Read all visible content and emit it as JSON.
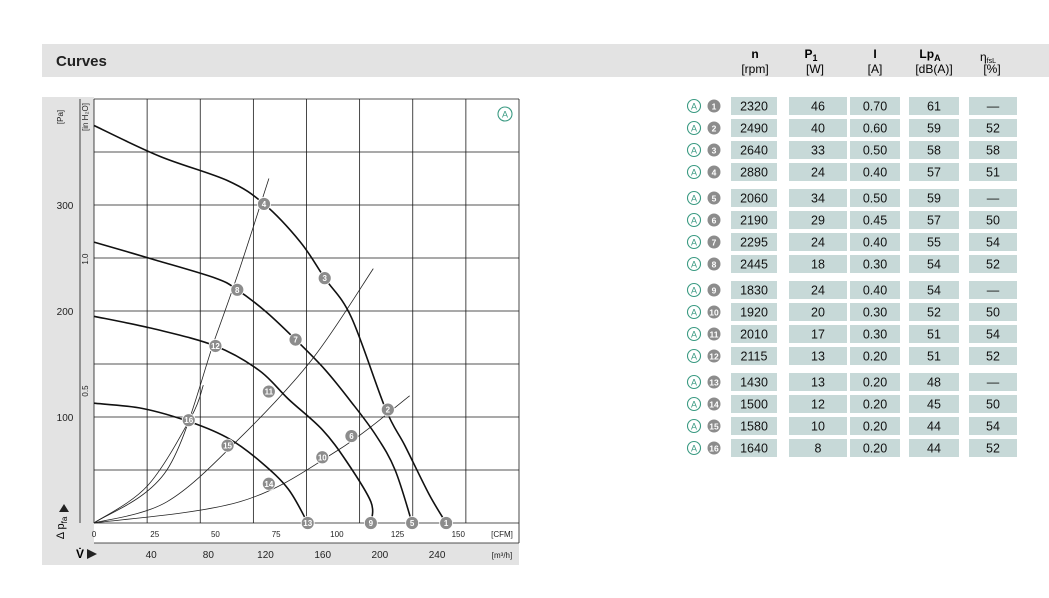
{
  "section_title": "Curves",
  "table": {
    "headers": [
      {
        "main": "n",
        "sub": "",
        "unit": "[rpm]"
      },
      {
        "main": "P",
        "sub": "1",
        "unit": "[W]"
      },
      {
        "main": "I",
        "sub": "",
        "unit": "[A]"
      },
      {
        "main": "Lp",
        "sub": "A",
        "unit": "[dB(A)]"
      },
      {
        "main": "η",
        "sub": "fsL",
        "unit": "[%]"
      }
    ],
    "groups": [
      [
        {
          "mode": "A",
          "id": "1",
          "n": "2320",
          "p1": "46",
          "i": "0.70",
          "lpa": "61",
          "eta": "—"
        },
        {
          "mode": "A",
          "id": "2",
          "n": "2490",
          "p1": "40",
          "i": "0.60",
          "lpa": "59",
          "eta": "52"
        },
        {
          "mode": "A",
          "id": "3",
          "n": "2640",
          "p1": "33",
          "i": "0.50",
          "lpa": "58",
          "eta": "58"
        },
        {
          "mode": "A",
          "id": "4",
          "n": "2880",
          "p1": "24",
          "i": "0.40",
          "lpa": "57",
          "eta": "51"
        }
      ],
      [
        {
          "mode": "A",
          "id": "5",
          "n": "2060",
          "p1": "34",
          "i": "0.50",
          "lpa": "59",
          "eta": "—"
        },
        {
          "mode": "A",
          "id": "6",
          "n": "2190",
          "p1": "29",
          "i": "0.45",
          "lpa": "57",
          "eta": "50"
        },
        {
          "mode": "A",
          "id": "7",
          "n": "2295",
          "p1": "24",
          "i": "0.40",
          "lpa": "55",
          "eta": "54"
        },
        {
          "mode": "A",
          "id": "8",
          "n": "2445",
          "p1": "18",
          "i": "0.30",
          "lpa": "54",
          "eta": "52"
        }
      ],
      [
        {
          "mode": "A",
          "id": "9",
          "n": "1830",
          "p1": "24",
          "i": "0.40",
          "lpa": "54",
          "eta": "—"
        },
        {
          "mode": "A",
          "id": "10",
          "n": "1920",
          "p1": "20",
          "i": "0.30",
          "lpa": "52",
          "eta": "50"
        },
        {
          "mode": "A",
          "id": "11",
          "n": "2010",
          "p1": "17",
          "i": "0.30",
          "lpa": "51",
          "eta": "54"
        },
        {
          "mode": "A",
          "id": "12",
          "n": "2115",
          "p1": "13",
          "i": "0.20",
          "lpa": "51",
          "eta": "52"
        }
      ],
      [
        {
          "mode": "A",
          "id": "13",
          "n": "1430",
          "p1": "13",
          "i": "0.20",
          "lpa": "48",
          "eta": "—"
        },
        {
          "mode": "A",
          "id": "14",
          "n": "1500",
          "p1": "12",
          "i": "0.20",
          "lpa": "45",
          "eta": "50"
        },
        {
          "mode": "A",
          "id": "15",
          "n": "1580",
          "p1": "10",
          "i": "0.20",
          "lpa": "44",
          "eta": "54"
        },
        {
          "mode": "A",
          "id": "16",
          "n": "1640",
          "p1": "8",
          "i": "0.20",
          "lpa": "44",
          "eta": "52"
        }
      ]
    ]
  },
  "colors": {
    "header_band": "#e3e3e3",
    "cell_fill": "#c7d9d8",
    "marker_fill": "#8c8c8c",
    "mode_badge": "#3a9a82",
    "grid": "#1a1a1a"
  },
  "chart_data": {
    "type": "line",
    "mode_label": "A",
    "x_cfm": {
      "ticks": [
        "0",
        "25",
        "50",
        "75",
        "100",
        "125",
        "150"
      ],
      "unit": "[CFM]",
      "range": [
        0,
        175
      ]
    },
    "x_m3h": {
      "ticks": [
        "40",
        "80",
        "120",
        "160",
        "200",
        "240"
      ],
      "unit": "[m³/h]"
    },
    "y_pa": {
      "ticks": [
        "100",
        "200",
        "300"
      ],
      "unit": "[Pa]",
      "range": [
        0,
        400
      ]
    },
    "y_inh2o": {
      "ticks": [
        "0.5",
        "1.0"
      ],
      "unit": "[in H₂O]"
    },
    "y_axis_symbol": "Δ p",
    "y_axis_symbol_sub": "fa",
    "x_axis_symbol": "V̇",
    "series": [
      {
        "points": [
          [
            0,
            375
          ],
          [
            27,
            346
          ],
          [
            55,
            323
          ],
          [
            70,
            301
          ],
          [
            85,
            265
          ],
          [
            95,
            231
          ],
          [
            106,
            194
          ],
          [
            120,
            108
          ],
          [
            128,
            73
          ],
          [
            138,
            27
          ],
          [
            145,
            0
          ]
        ]
      },
      {
        "points": [
          [
            0,
            265
          ],
          [
            24,
            249
          ],
          [
            50,
            231
          ],
          [
            59,
            220
          ],
          [
            71,
            199
          ],
          [
            83,
            173
          ],
          [
            95,
            145
          ],
          [
            106,
            114
          ],
          [
            116,
            83
          ],
          [
            124,
            50
          ],
          [
            131,
            0
          ]
        ]
      },
      {
        "points": [
          [
            0,
            195
          ],
          [
            25,
            183
          ],
          [
            50,
            167
          ],
          [
            68,
            144
          ],
          [
            80,
            117
          ],
          [
            94,
            88
          ],
          [
            104,
            58
          ],
          [
            114,
            20
          ],
          [
            114,
            0
          ]
        ]
      },
      {
        "points": [
          [
            0,
            113
          ],
          [
            20,
            108
          ],
          [
            40,
            95
          ],
          [
            56,
            79
          ],
          [
            69,
            57
          ],
          [
            80,
            32
          ],
          [
            88,
            0
          ]
        ]
      }
    ],
    "operating_points": [
      {
        "id": "1",
        "x": 145,
        "y": 0
      },
      {
        "id": "2",
        "x": 121,
        "y": 107
      },
      {
        "id": "3",
        "x": 95,
        "y": 231
      },
      {
        "id": "4",
        "x": 70,
        "y": 301
      },
      {
        "id": "5",
        "x": 131,
        "y": 0
      },
      {
        "id": "6",
        "x": 106,
        "y": 82
      },
      {
        "id": "7",
        "x": 83,
        "y": 173
      },
      {
        "id": "8",
        "x": 59,
        "y": 220
      },
      {
        "id": "9",
        "x": 114,
        "y": 0
      },
      {
        "id": "10",
        "x": 94,
        "y": 62
      },
      {
        "id": "11",
        "x": 72,
        "y": 124
      },
      {
        "id": "12",
        "x": 50,
        "y": 167
      },
      {
        "id": "13",
        "x": 88,
        "y": 0
      },
      {
        "id": "14",
        "x": 72,
        "y": 37
      },
      {
        "id": "15",
        "x": 55,
        "y": 73
      },
      {
        "id": "16",
        "x": 39,
        "y": 97
      }
    ],
    "system_curves": [
      {
        "points": [
          [
            0,
            0
          ],
          [
            60,
            20
          ],
          [
            100,
            68
          ],
          [
            130,
            120
          ]
        ]
      },
      {
        "points": [
          [
            0,
            0
          ],
          [
            30,
            20
          ],
          [
            60,
            80
          ],
          [
            90,
            155
          ],
          [
            115,
            240
          ]
        ]
      },
      {
        "points": [
          [
            0,
            0
          ],
          [
            30,
            50
          ],
          [
            50,
            175
          ],
          [
            60,
            240
          ],
          [
            72,
            325
          ]
        ]
      },
      {
        "points": [
          [
            0,
            0
          ],
          [
            22,
            35
          ],
          [
            40,
            100
          ],
          [
            45,
            130
          ]
        ]
      }
    ]
  }
}
